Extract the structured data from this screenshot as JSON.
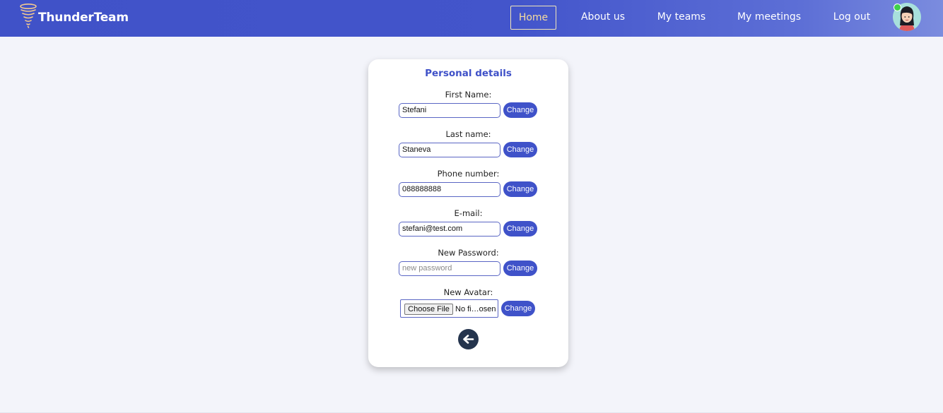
{
  "brand": {
    "name": "ThunderTeam",
    "logo_icon": "tornado-icon"
  },
  "nav": {
    "home": "Home",
    "about": "About us",
    "teams": "My teams",
    "meetings": "My meetings",
    "logout": "Log out",
    "active": "Home"
  },
  "profile": {
    "avatar_icon": "user-avatar",
    "status": "online"
  },
  "card": {
    "title": "Personal details",
    "fields": [
      {
        "label": "First Name:",
        "value": "Stefani",
        "placeholder": "",
        "button": "Change"
      },
      {
        "label": "Last name:",
        "value": "Staneva",
        "placeholder": "",
        "button": "Change"
      },
      {
        "label": "Phone number:",
        "value": "088888888",
        "placeholder": "",
        "button": "Change"
      },
      {
        "label": "E-mail:",
        "value": "stefani@test.com",
        "placeholder": "",
        "button": "Change"
      },
      {
        "label": "New Password:",
        "value": "",
        "placeholder": "new password",
        "button": "Change"
      }
    ],
    "avatar_field": {
      "label": "New Avatar:",
      "choose_label": "Choose File",
      "file_name": "No fi…osen",
      "button": "Change"
    },
    "back_icon": "arrow-left-icon"
  },
  "colors": {
    "primary": "#3f52c9",
    "navbar": "#4355cb",
    "active_nav": "#f6dc9e",
    "back_button": "#24344d",
    "background": "#f3f4fa"
  }
}
